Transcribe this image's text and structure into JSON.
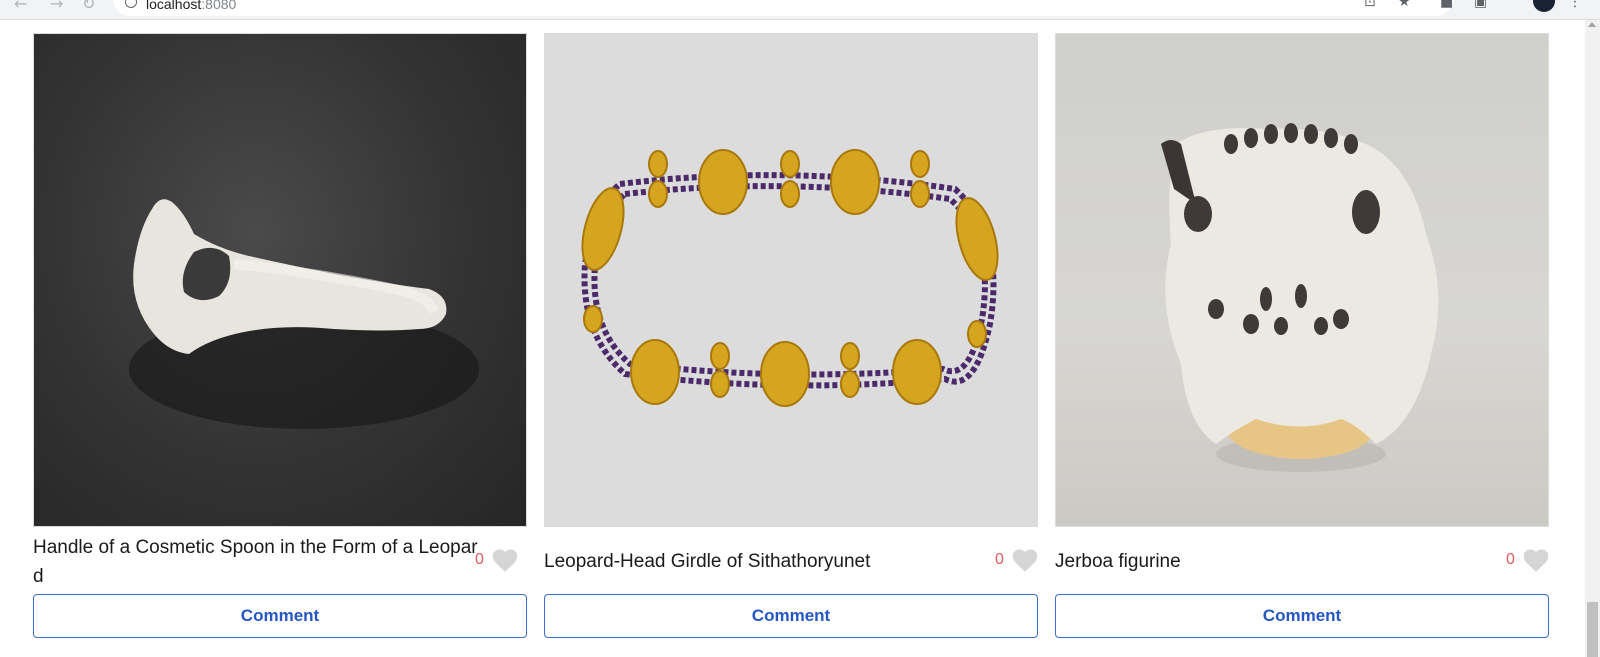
{
  "browser": {
    "url_host": "localhost",
    "url_port": ":8080"
  },
  "gallery": {
    "cards": [
      {
        "title": "Handle of a Cosmetic Spoon in the Form of a Leopard",
        "likes": "0",
        "comment_label": "Comment",
        "image": "alabaster-leopard-spoon-handle"
      },
      {
        "title": "Leopard-Head Girdle of Sithathoryunet",
        "likes": "0",
        "comment_label": "Comment",
        "image": "gold-amethyst-girdle"
      },
      {
        "title": "Jerboa figurine",
        "likes": "0",
        "comment_label": "Comment",
        "image": "white-jerboa-figurine"
      }
    ]
  },
  "colors": {
    "accent": "#2456c5",
    "like": "#e05b5b",
    "heart": "#d5d5d5"
  }
}
